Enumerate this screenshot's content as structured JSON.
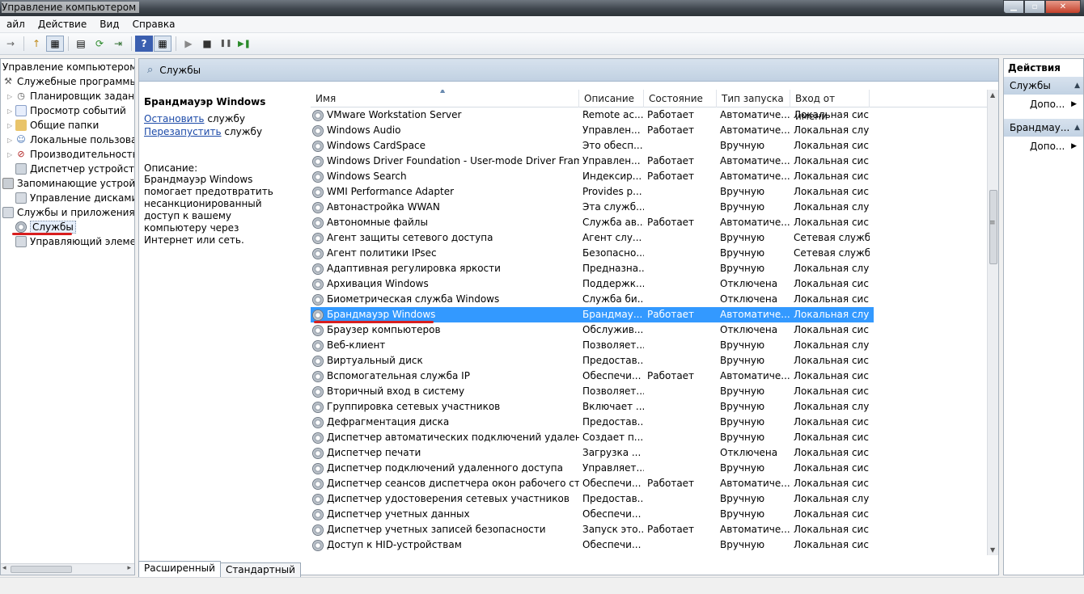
{
  "window": {
    "title": "Управление компьютером",
    "min_glyph": "▁",
    "max_glyph": "▫",
    "close_glyph": "✕"
  },
  "menu": [
    "айл",
    "Действие",
    "Вид",
    "Справка"
  ],
  "toolbar": [
    "→",
    "↑",
    "▦",
    "▤",
    "⟳",
    "⇥",
    "?",
    "▦",
    "▶",
    "■",
    "❚❚",
    "▶❚"
  ],
  "tree": {
    "root": "Управление компьютером (л",
    "items": [
      {
        "label": "Служебные программы",
        "level": 1,
        "icon": "tools-icon"
      },
      {
        "label": "Планировщик заданий",
        "level": 2,
        "icon": "clock-icon"
      },
      {
        "label": "Просмотр событий",
        "level": 2,
        "icon": "event-viewer-icon"
      },
      {
        "label": "Общие папки",
        "level": 2,
        "icon": "shared-folder-icon"
      },
      {
        "label": "Локальные пользовате",
        "level": 2,
        "icon": "users-icon"
      },
      {
        "label": "Производительность",
        "level": 2,
        "icon": "performance-icon"
      },
      {
        "label": "Диспетчер устройств",
        "level": 2,
        "icon": "device-manager-icon"
      },
      {
        "label": "Запоминающие устройст",
        "level": 1,
        "icon": "storage-icon"
      },
      {
        "label": "Управление дисками",
        "level": 2,
        "icon": "disk-icon"
      },
      {
        "label": "Службы и приложения",
        "level": 1,
        "icon": "services-apps-icon"
      },
      {
        "label": "Службы",
        "level": 2,
        "icon": "gear-icon"
      },
      {
        "label": "Управляющий элемен",
        "level": 2,
        "icon": "wmi-icon"
      }
    ]
  },
  "center": {
    "header": "Службы",
    "selected_service": "Брандмауэр Windows",
    "stop_link": "Остановить",
    "stop_rest": " службу",
    "restart_link": "Перезапустить",
    "restart_rest": " службу",
    "description_label": "Описание:",
    "description_text": "Брандмауэр Windows помогает предотвратить несанкционированный доступ к вашему компьютеру через Интернет или сеть."
  },
  "columns": [
    "Имя",
    "Описание",
    "Состояние",
    "Тип запуска",
    "Вход от имени"
  ],
  "rows": [
    [
      "VMware Workstation Server",
      "Remote ac...",
      "Работает",
      "Автоматиче...",
      "Локальная сис..."
    ],
    [
      "Windows Audio",
      "Управлен...",
      "Работает",
      "Автоматиче...",
      "Локальная слу..."
    ],
    [
      "Windows CardSpace",
      "Это обесп...",
      "",
      "Вручную",
      "Локальная сис..."
    ],
    [
      "Windows Driver Foundation - User-mode Driver Framew...",
      "Управлен...",
      "Работает",
      "Автоматиче...",
      "Локальная сис..."
    ],
    [
      "Windows Search",
      "Индексир...",
      "Работает",
      "Автоматиче...",
      "Локальная сис..."
    ],
    [
      "WMI Performance Adapter",
      "Provides p...",
      "",
      "Вручную",
      "Локальная сис..."
    ],
    [
      "Автонастройка WWAN",
      "Эта служб...",
      "",
      "Вручную",
      "Локальная слу..."
    ],
    [
      "Автономные файлы",
      "Служба ав...",
      "Работает",
      "Автоматиче...",
      "Локальная сис..."
    ],
    [
      "Агент защиты сетевого доступа",
      "Агент слу...",
      "",
      "Вручную",
      "Сетевая служба"
    ],
    [
      "Агент политики IPsec",
      "Безопасно...",
      "",
      "Вручную",
      "Сетевая служба"
    ],
    [
      "Адаптивная регулировка яркости",
      "Предназна...",
      "",
      "Вручную",
      "Локальная слу..."
    ],
    [
      "Архивация Windows",
      "Поддержк...",
      "",
      "Отключена",
      "Локальная сис..."
    ],
    [
      "Биометрическая служба Windows",
      "Служба би...",
      "",
      "Отключена",
      "Локальная сис..."
    ],
    [
      "Брандмауэр Windows",
      "Брандмау...",
      "Работает",
      "Автоматиче...",
      "Локальная слу..."
    ],
    [
      "Браузер компьютеров",
      "Обслужив...",
      "",
      "Отключена",
      "Локальная сис..."
    ],
    [
      "Веб-клиент",
      "Позволяет...",
      "",
      "Вручную",
      "Локальная слу..."
    ],
    [
      "Виртуальный диск",
      "Предостав...",
      "",
      "Вручную",
      "Локальная сис..."
    ],
    [
      "Вспомогательная служба IP",
      "Обеспечи...",
      "Работает",
      "Автоматиче...",
      "Локальная сис..."
    ],
    [
      "Вторичный вход в систему",
      "Позволяет...",
      "",
      "Вручную",
      "Локальная сис..."
    ],
    [
      "Группировка сетевых участников",
      "Включает ...",
      "",
      "Вручную",
      "Локальная слу..."
    ],
    [
      "Дефрагментация диска",
      "Предостав...",
      "",
      "Вручную",
      "Локальная сис..."
    ],
    [
      "Диспетчер автоматических подключений удаленного...",
      "Создает п...",
      "",
      "Вручную",
      "Локальная сис..."
    ],
    [
      "Диспетчер печати",
      "Загрузка ...",
      "",
      "Отключена",
      "Локальная сис..."
    ],
    [
      "Диспетчер подключений удаленного доступа",
      "Управляет...",
      "",
      "Вручную",
      "Локальная сис..."
    ],
    [
      "Диспетчер сеансов диспетчера окон рабочего стола",
      "Обеспечи...",
      "Работает",
      "Автоматиче...",
      "Локальная сис..."
    ],
    [
      "Диспетчер удостоверения сетевых участников",
      "Предостав...",
      "",
      "Вручную",
      "Локальная слу..."
    ],
    [
      "Диспетчер учетных данных",
      "Обеспечи...",
      "",
      "Вручную",
      "Локальная сис..."
    ],
    [
      "Диспетчер учетных записей безопасности",
      "Запуск это...",
      "Работает",
      "Автоматиче...",
      "Локальная сис..."
    ],
    [
      "Доступ к HID-устройствам",
      "Обеспечи...",
      "",
      "Вручную",
      "Локальная сис..."
    ]
  ],
  "selected_row": 13,
  "tabs": [
    "Расширенный",
    "Стандартный"
  ],
  "actions": {
    "header": "Действия",
    "sections": [
      {
        "title": "Службы",
        "item": "Допо..."
      },
      {
        "title": "Брандмау...",
        "item": "Допо..."
      }
    ]
  },
  "colors": {
    "selection": "#3399ff",
    "annotation_underline": "#d81e1e",
    "link": "#1c4aa8"
  }
}
